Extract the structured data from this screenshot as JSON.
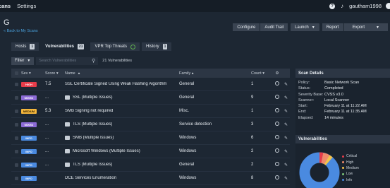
{
  "topnav": {
    "scans": "cans",
    "settings": "Settings",
    "help_icon": "?",
    "user": "gautham1998"
  },
  "scan": {
    "title": "G",
    "back": "« Back to My Scans"
  },
  "toolbar": {
    "configure": "Configure",
    "audit_trail": "Audit Trail",
    "launch": "Launch",
    "report": "Report",
    "export": "Export"
  },
  "tabs": [
    {
      "label": "Hosts",
      "count": "1"
    },
    {
      "label": "Vulnerabilities",
      "count": "21"
    },
    {
      "label": "VPR Top Threats",
      "count": ""
    },
    {
      "label": "History",
      "count": "1"
    }
  ],
  "filter": {
    "label": "Filter",
    "placeholder": "Search Vulnerabilities",
    "count_text": "21 Vulnerabilities"
  },
  "table": {
    "headers": {
      "sev": "Sev",
      "score": "Score",
      "name": "Name",
      "family": "Family",
      "count": "Count"
    },
    "rows": [
      {
        "sev": "HIGH",
        "score": "7.5",
        "name": "SSL Certificate Signed Using Weak Hashing Algorithm",
        "family": "General",
        "count": "1"
      },
      {
        "sev": "MIXED",
        "score": "...",
        "name": "SSL (Multiple Issues)",
        "family": "General",
        "count": "9"
      },
      {
        "sev": "MEDIUM",
        "score": "5.3",
        "name": "SMB Signing not required",
        "family": "Misc.",
        "count": "1"
      },
      {
        "sev": "MIXED",
        "score": "...",
        "name": "TLS (Multiple Issues)",
        "family": "Service detection",
        "count": "3"
      },
      {
        "sev": "INFO",
        "score": "...",
        "name": "SMB (Multiple Issues)",
        "family": "Windows",
        "count": "6"
      },
      {
        "sev": "INFO",
        "score": "...",
        "name": "Microsoft Windows (Multiple Issues)",
        "family": "Windows",
        "count": "2"
      },
      {
        "sev": "INFO",
        "score": "...",
        "name": "TLS (Multiple Issues)",
        "family": "General",
        "count": "2"
      },
      {
        "sev": "INFO",
        "score": "",
        "name": "DCE Services Enumeration",
        "family": "Windows",
        "count": "8"
      }
    ]
  },
  "details": {
    "title": "Scan Details",
    "rows": [
      {
        "k": "Policy:",
        "v": "Basic Network Scan"
      },
      {
        "k": "Status:",
        "v": "Completed"
      },
      {
        "k": "Severity Base:",
        "v": "CVSS v3.0"
      },
      {
        "k": "Scanner:",
        "v": "Local Scanner"
      },
      {
        "k": "Start:",
        "v": "February 11 at 11:22 AM"
      },
      {
        "k": "End:",
        "v": "February 11 at 11:35 AM"
      },
      {
        "k": "Elapsed:",
        "v": "14 minutes"
      }
    ],
    "vuln_title": "Vulnerabilities",
    "legend": [
      "Critical",
      "High",
      "Medium",
      "Low",
      "Info"
    ]
  },
  "colors": {
    "critical": "#e63c4a",
    "high": "#f08a6a",
    "medium": "#f4c24a",
    "low": "#7bc67a",
    "info": "#4a8ae0"
  }
}
